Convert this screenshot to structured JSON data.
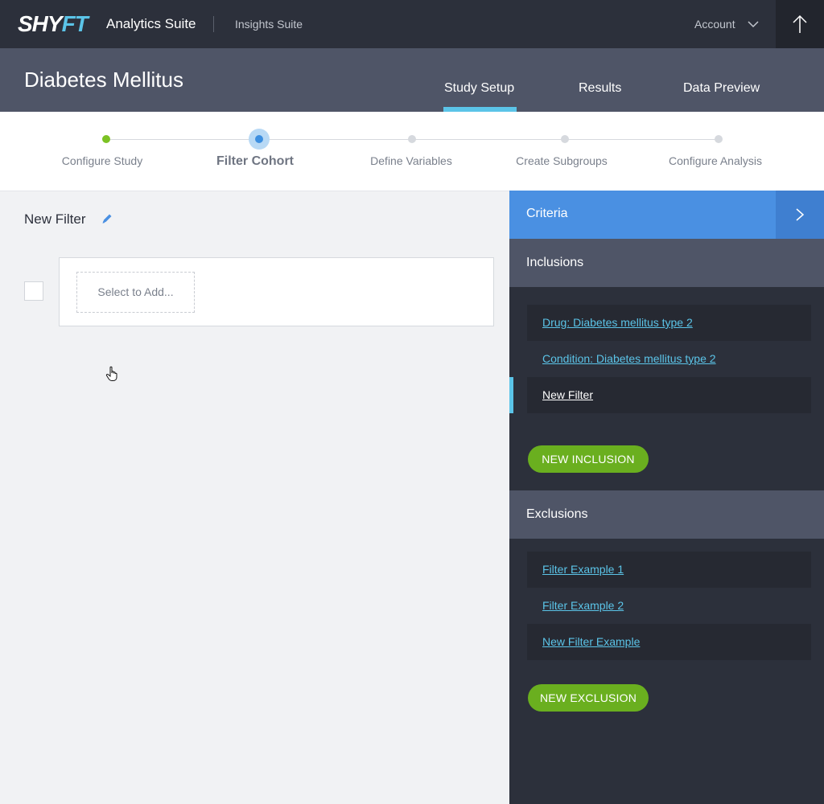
{
  "header": {
    "logo_part1": "SHY",
    "logo_part2": "FT",
    "app_name": "Analytics Suite",
    "secondary_app": "Insights Suite",
    "account_label": "Account"
  },
  "study": {
    "title": "Diabetes Mellitus",
    "tabs": [
      {
        "label": "Study Setup",
        "active": true
      },
      {
        "label": "Results",
        "active": false
      },
      {
        "label": "Data Preview",
        "active": false
      }
    ]
  },
  "stepper": {
    "steps": [
      {
        "label": "Configure Study",
        "state": "done"
      },
      {
        "label": "Filter Cohort",
        "state": "active"
      },
      {
        "label": "Define Variables",
        "state": "pending"
      },
      {
        "label": "Create Subgroups",
        "state": "pending"
      },
      {
        "label": "Configure Analysis",
        "state": "pending"
      }
    ]
  },
  "filter": {
    "title": "New Filter",
    "select_placeholder": "Select to Add..."
  },
  "criteria": {
    "title": "Criteria",
    "inclusions": {
      "label": "Inclusions",
      "items": [
        {
          "label": "Drug: Diabetes mellitus type 2"
        },
        {
          "label": "Condition: Diabetes mellitus type 2"
        },
        {
          "label": "New Filter",
          "selected": true
        }
      ],
      "button": "NEW INCLUSION"
    },
    "exclusions": {
      "label": "Exclusions",
      "items": [
        {
          "label": "Filter Example 1"
        },
        {
          "label": "Filter Example 2"
        },
        {
          "label": "New Filter Example"
        }
      ],
      "button": "NEW EXCLUSION"
    }
  },
  "colors": {
    "accent_blue": "#4a90e2",
    "accent_cyan": "#5bc4e8",
    "accent_green": "#6aaf1f",
    "panel_dark": "#2c303b"
  }
}
